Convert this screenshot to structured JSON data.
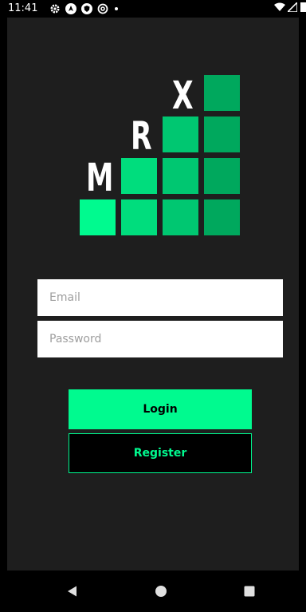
{
  "status_bar": {
    "time": "11:41",
    "icons": [
      "settings-gear-icon",
      "navigation-app-icon",
      "shield-icon",
      "at-sign-icon",
      "notification-dot-icon"
    ],
    "right_icons": [
      "wifi-icon",
      "signal-icon",
      "battery-icon"
    ]
  },
  "logo": {
    "letters": [
      "M",
      "R",
      "X"
    ],
    "colors": {
      "brightest": "#00fa8f",
      "bright": "#00dd7d",
      "mid": "#00c771",
      "dark": "#00a85d"
    }
  },
  "login_form": {
    "email_placeholder": "Email",
    "email_value": "",
    "password_placeholder": "Password",
    "password_value": ""
  },
  "buttons": {
    "login_label": "Login",
    "register_label": "Register"
  },
  "colors": {
    "accent": "#00fa8f",
    "background": "#1e1e1e"
  },
  "nav": {
    "items": [
      "back-icon",
      "home-icon",
      "recents-icon"
    ]
  }
}
